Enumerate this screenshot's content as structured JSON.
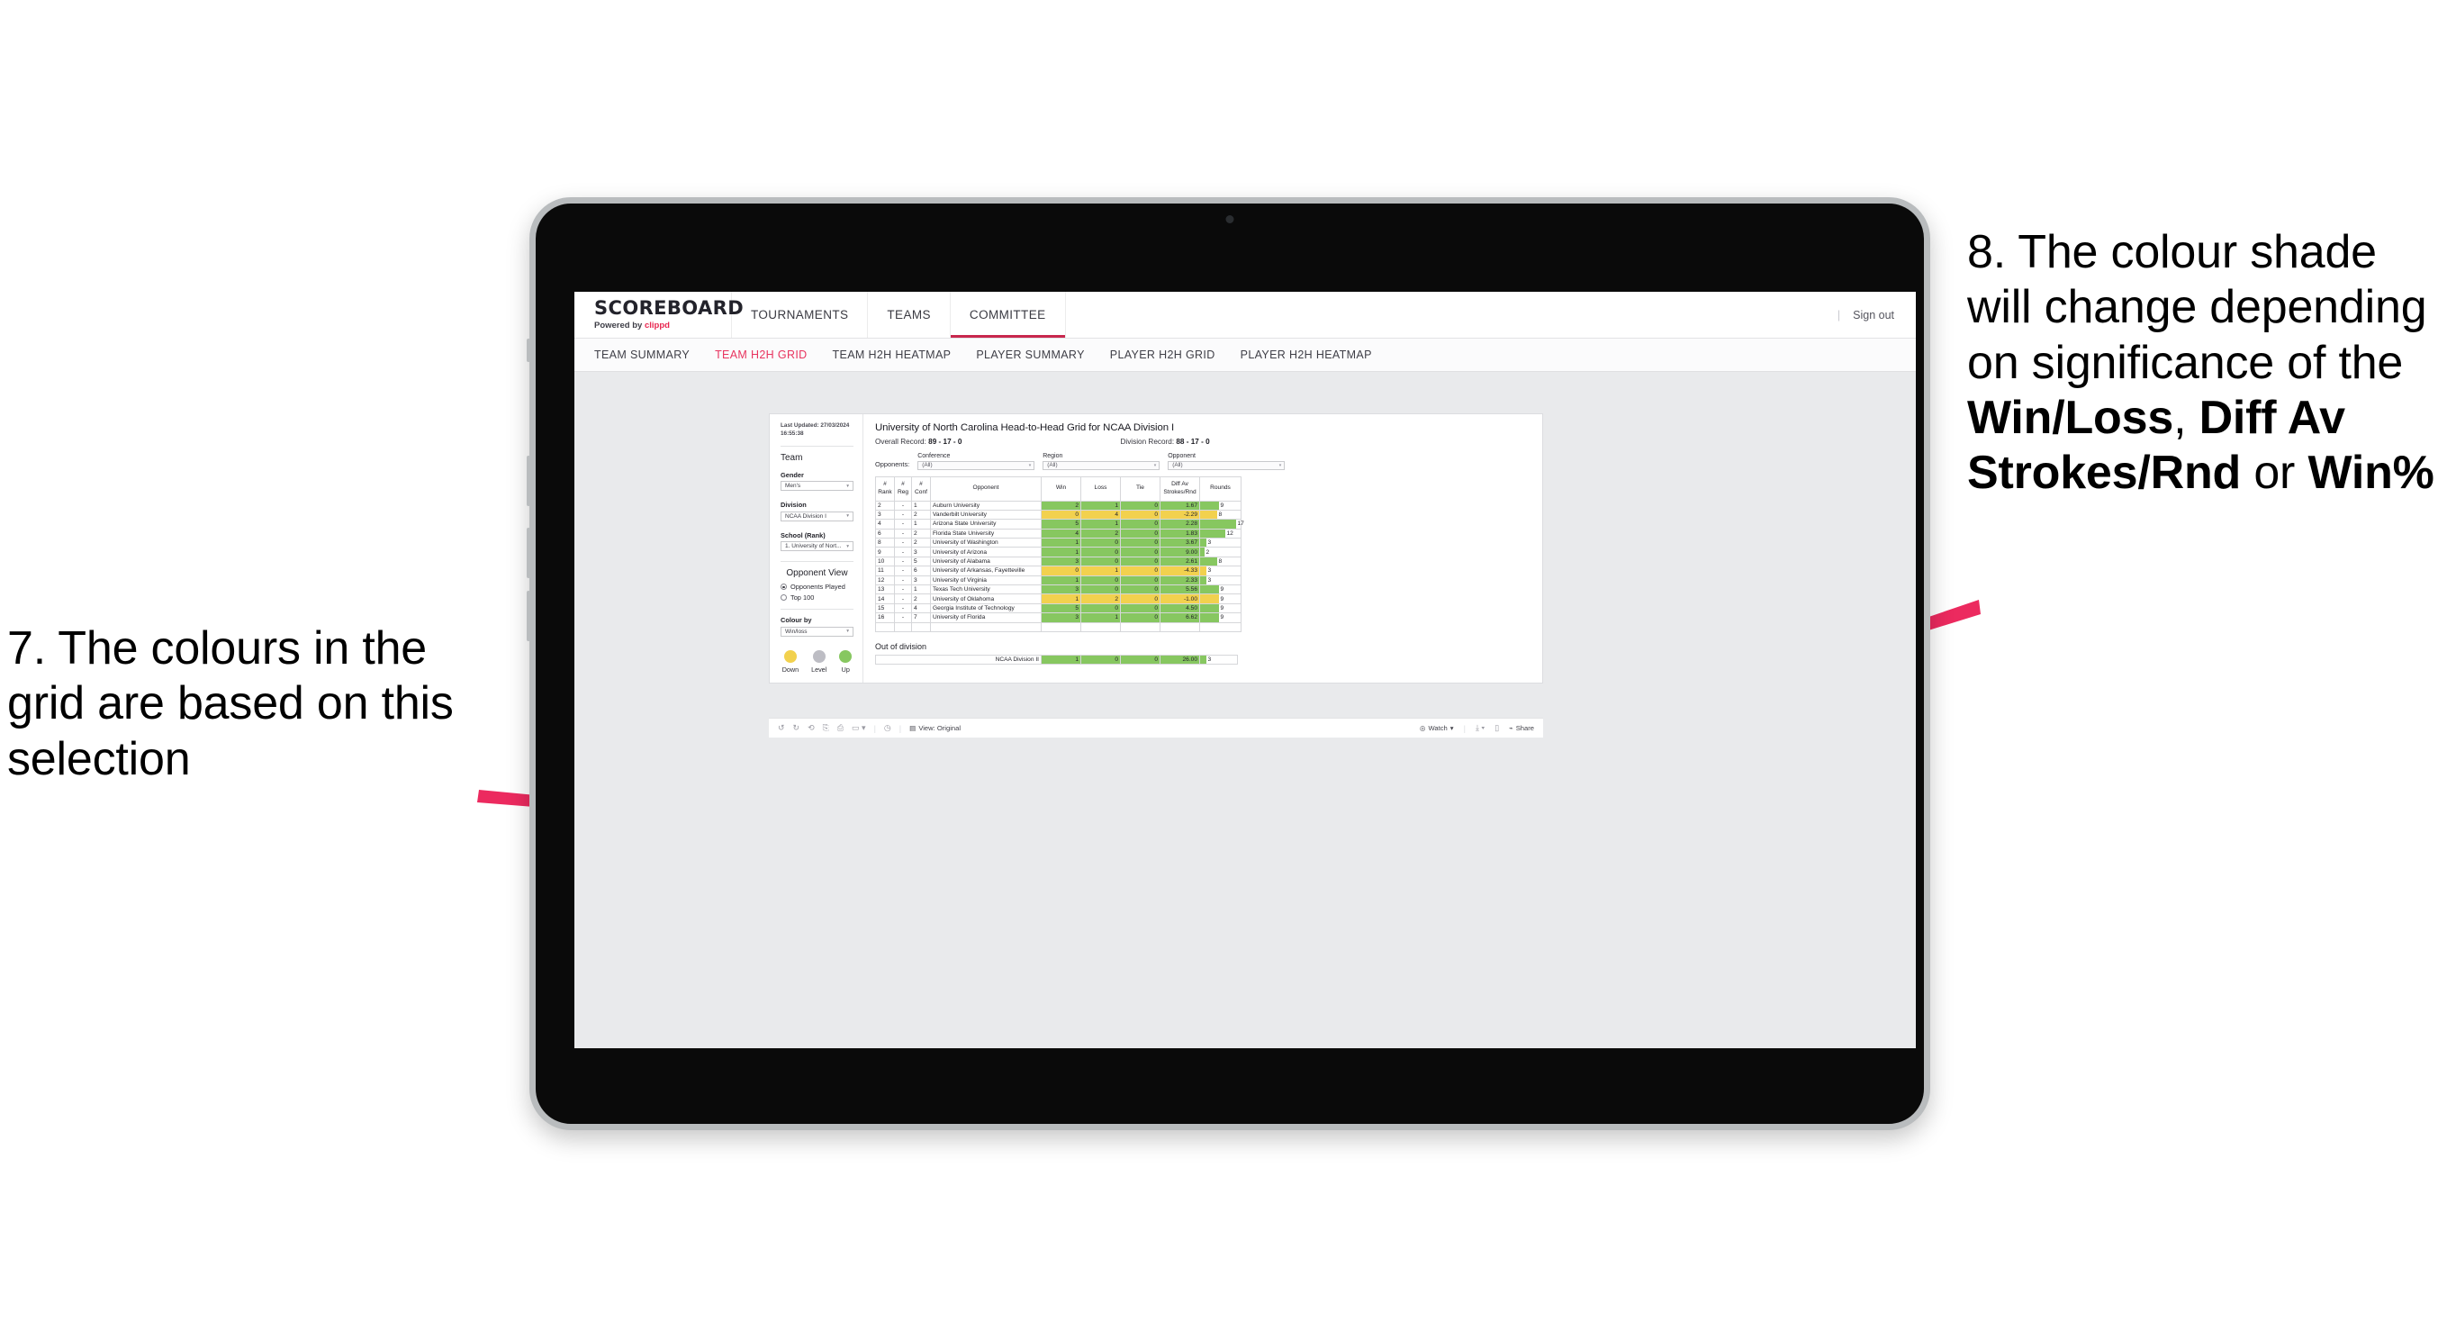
{
  "annotations": {
    "left": {
      "number": "7.",
      "text": "The colours in the grid are based on this selection"
    },
    "right": {
      "prefix": "8. The colour shade will change depending on significance of the ",
      "bold1": "Win/Loss",
      "mid1": ", ",
      "bold2": "Diff Av Strokes/Rnd",
      "mid2": " or ",
      "bold3": "Win%"
    },
    "arrow_color": "#ec2a5f"
  },
  "app": {
    "brand": {
      "title": "SCOREBOARD",
      "powered_prefix": "Powered by ",
      "powered_name": "clippd"
    },
    "topnav": [
      {
        "label": "TOURNAMENTS",
        "active": false
      },
      {
        "label": "TEAMS",
        "active": false
      },
      {
        "label": "COMMITTEE",
        "active": true
      }
    ],
    "signout": "Sign out",
    "subnav": [
      {
        "label": "TEAM SUMMARY",
        "active": false
      },
      {
        "label": "TEAM H2H GRID",
        "active": true
      },
      {
        "label": "TEAM H2H HEATMAP",
        "active": false
      },
      {
        "label": "PLAYER SUMMARY",
        "active": false
      },
      {
        "label": "PLAYER H2H GRID",
        "active": false
      },
      {
        "label": "PLAYER H2H HEATMAP",
        "active": false
      }
    ],
    "accent": "#e8345f"
  },
  "sidebar": {
    "last_updated": "Last Updated: 27/03/2024 16:55:38",
    "team_heading": "Team",
    "gender": {
      "label": "Gender",
      "value": "Men's"
    },
    "division": {
      "label": "Division",
      "value": "NCAA Division I"
    },
    "school": {
      "label": "School (Rank)",
      "value": "1. University of Nort..."
    },
    "opponent_view": {
      "heading": "Opponent View",
      "options": [
        {
          "label": "Opponents Played",
          "selected": true
        },
        {
          "label": "Top 100",
          "selected": false
        }
      ]
    },
    "colour_by": {
      "label": "Colour by",
      "value": "Win/loss"
    },
    "legend": [
      {
        "label": "Down",
        "color": "#f2d14e"
      },
      {
        "label": "Level",
        "color": "#bdbdc4"
      },
      {
        "label": "Up",
        "color": "#87c760"
      }
    ]
  },
  "viz": {
    "title": "University of North Carolina Head-to-Head Grid for NCAA Division I",
    "overall_record_label": "Overall Record: ",
    "overall_record_value": "89 - 17 - 0",
    "division_record_label": "Division Record: ",
    "division_record_value": "88 - 17 - 0",
    "opponents_label": "Opponents:",
    "filters": [
      {
        "label": "Conference",
        "value": "(All)"
      },
      {
        "label": "Region",
        "value": "(All)"
      },
      {
        "label": "Opponent",
        "value": "(All)"
      }
    ],
    "columns": [
      "# Rank",
      "# Reg",
      "# Conf",
      "Opponent",
      "Win",
      "Loss",
      "Tie",
      "Diff Av Strokes/Rnd",
      "Rounds"
    ],
    "out_of_division_heading": "Out of division"
  },
  "chart_data": {
    "type": "table",
    "title": "University of North Carolina Head-to-Head Grid for NCAA Division I",
    "columns": [
      "#Rank",
      "#Reg",
      "#Conf",
      "Opponent",
      "Win",
      "Loss",
      "Tie",
      "Diff Av Strokes/Rnd",
      "Rounds"
    ],
    "colour_by": "Win/loss",
    "colour_scale": {
      "up": "#87c760",
      "level": "#bdbdc4",
      "down": "#f2d14e"
    },
    "rounds_max": 17,
    "rows": [
      {
        "rank": "2",
        "reg": "-",
        "conf": "1",
        "opponent": "Auburn University",
        "win": 2,
        "loss": 1,
        "tie": 0,
        "diff": "1.67",
        "rounds": 9,
        "state": "up"
      },
      {
        "rank": "3",
        "reg": "-",
        "conf": "2",
        "opponent": "Vanderbilt University",
        "win": 0,
        "loss": 4,
        "tie": 0,
        "diff": "-2.29",
        "rounds": 8,
        "state": "down"
      },
      {
        "rank": "4",
        "reg": "-",
        "conf": "1",
        "opponent": "Arizona State University",
        "win": 5,
        "loss": 1,
        "tie": 0,
        "diff": "2.28",
        "rounds": 17,
        "state": "up"
      },
      {
        "rank": "6",
        "reg": "-",
        "conf": "2",
        "opponent": "Florida State University",
        "win": 4,
        "loss": 2,
        "tie": 0,
        "diff": "1.83",
        "rounds": 12,
        "state": "up"
      },
      {
        "rank": "8",
        "reg": "-",
        "conf": "2",
        "opponent": "University of Washington",
        "win": 1,
        "loss": 0,
        "tie": 0,
        "diff": "3.67",
        "rounds": 3,
        "state": "up"
      },
      {
        "rank": "9",
        "reg": "-",
        "conf": "3",
        "opponent": "University of Arizona",
        "win": 1,
        "loss": 0,
        "tie": 0,
        "diff": "9.00",
        "rounds": 2,
        "state": "up"
      },
      {
        "rank": "10",
        "reg": "-",
        "conf": "5",
        "opponent": "University of Alabama",
        "win": 3,
        "loss": 0,
        "tie": 0,
        "diff": "2.61",
        "rounds": 8,
        "state": "up"
      },
      {
        "rank": "11",
        "reg": "-",
        "conf": "6",
        "opponent": "University of Arkansas, Fayetteville",
        "win": 0,
        "loss": 1,
        "tie": 0,
        "diff": "-4.33",
        "rounds": 3,
        "state": "down"
      },
      {
        "rank": "12",
        "reg": "-",
        "conf": "3",
        "opponent": "University of Virginia",
        "win": 1,
        "loss": 0,
        "tie": 0,
        "diff": "2.33",
        "rounds": 3,
        "state": "up"
      },
      {
        "rank": "13",
        "reg": "-",
        "conf": "1",
        "opponent": "Texas Tech University",
        "win": 3,
        "loss": 0,
        "tie": 0,
        "diff": "5.56",
        "rounds": 9,
        "state": "up"
      },
      {
        "rank": "14",
        "reg": "-",
        "conf": "2",
        "opponent": "University of Oklahoma",
        "win": 1,
        "loss": 2,
        "tie": 0,
        "diff": "-1.00",
        "rounds": 9,
        "state": "down"
      },
      {
        "rank": "15",
        "reg": "-",
        "conf": "4",
        "opponent": "Georgia Institute of Technology",
        "win": 5,
        "loss": 0,
        "tie": 0,
        "diff": "4.50",
        "rounds": 9,
        "state": "up"
      },
      {
        "rank": "16",
        "reg": "-",
        "conf": "7",
        "opponent": "University of Florida",
        "win": 3,
        "loss": 1,
        "tie": 0,
        "diff": "6.62",
        "rounds": 9,
        "state": "up"
      }
    ],
    "out_of_division": [
      {
        "opponent": "NCAA Division II",
        "win": 1,
        "loss": 0,
        "tie": 0,
        "diff": "26.00",
        "rounds": 3,
        "state": "up"
      }
    ]
  },
  "toolbar": {
    "view_label": "View: Original",
    "watch_label": "Watch",
    "share_label": "Share"
  }
}
